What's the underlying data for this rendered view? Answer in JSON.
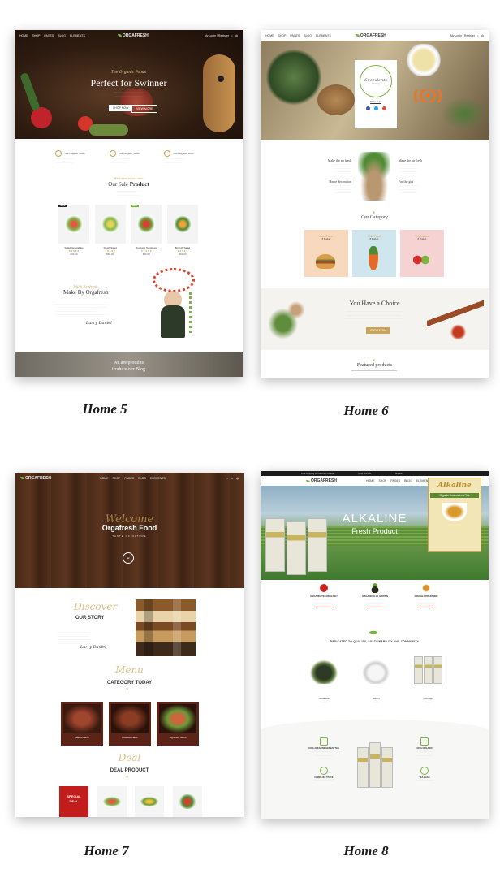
{
  "brand": "ORGAFRESH",
  "nav_links": [
    "HOME",
    "SHOP",
    "PAGES",
    "BLOG",
    "ELEMENTS"
  ],
  "nav_account": "My Login / Register",
  "home5": {
    "caption": "Home 5",
    "hero_script": "The Organic Foods",
    "hero_title": "Perfect for Swinner",
    "hero_btn1": "SHOP NOW",
    "hero_btn2": "VIEW MORE",
    "features": [
      {
        "title": "The Organic Store"
      },
      {
        "title": "The Organic Store"
      },
      {
        "title": "The Organic Store"
      }
    ],
    "sale_script": "Welcome to our sale",
    "sale_title_a": "Our Sale ",
    "sale_title_b": "Product",
    "badges": [
      "SALE",
      "NEW"
    ],
    "products": [
      {
        "name": "Salad Vegetables",
        "price": "$99.00"
      },
      {
        "name": "Fresh Salad",
        "price": "$99.00"
      },
      {
        "name": "Avocado Tomatoes",
        "price": "$99.00"
      },
      {
        "name": "Brocolli Salad",
        "price": "$99.00"
      }
    ],
    "about_script": "100% Ecofresh",
    "about_title": "Make By Orgafresh",
    "signature": "Larry Daniel",
    "blog_title_1": "We are proud to",
    "blog_title_2": "troduce our Blog"
  },
  "home6": {
    "caption": "Home 6",
    "hero_card_script": "Succulents",
    "hero_card_sub": "Trending",
    "hero_card_link": "Shop Now",
    "blocks": [
      {
        "title": "Make the air fresh"
      },
      {
        "title": "Make the air fresh"
      },
      {
        "title": "Home decoration"
      },
      {
        "title": "For the gift"
      }
    ],
    "category_title": "Our Category",
    "categories": [
      {
        "name": "Fast Food",
        "count": "8 Product",
        "bg": "#f8d9bd"
      },
      {
        "name": "Fish Food",
        "count": "8 Product",
        "bg": "#cfe6ee"
      },
      {
        "name": "Vegetables",
        "count": "8 Product",
        "bg": "#f6d3d3"
      }
    ],
    "choice_title": "You Have a Choice",
    "choice_btn": "SHOP NOW",
    "featured_title": "Featured products"
  },
  "home7": {
    "caption": "Home 7",
    "hero_script": "Welcome",
    "hero_title": "Orgafresh Food",
    "hero_sub": "TASTE OF NATURE",
    "story_script": "Discover",
    "story_title": "OUR STORY",
    "signature": "Larry Daniel",
    "cat_script": "Menu",
    "cat_title": "CATEGORY TODAY",
    "categories": [
      "Beef & Lamb",
      "Roasted Lamb",
      "Signature Menu"
    ],
    "deal_script": "Deal",
    "deal_title": "DEAL PRODUCT",
    "special_1": "SPECIAL",
    "special_2": "DEAL"
  },
  "home8": {
    "caption": "Home 8",
    "topbar": [
      "Free Shipping For All Order Of $99",
      "(000) 123-456",
      "English"
    ],
    "hero_title": "ALKALINE",
    "hero_sub": "Fresh Product",
    "pack_brand": "Alkaline",
    "pack_sub": "Organic Rooibos Leaf Tea",
    "features": [
      {
        "title": "ORGANIC TECHNOLOGY"
      },
      {
        "title": "ORGANICALLY GROWN"
      },
      {
        "title": "FRESHLY PREPARED"
      }
    ],
    "tagline": "DEDICATED TO QUALITY, SUSTAINABILITY AND COMMUNITY",
    "products": [
      "Loose Tea",
      "Tea Pot",
      "Tea Bags"
    ],
    "bottom_features": [
      "100% ALKALINE HERBAL TEA",
      "100% ORGANIC",
      "FARM LIKE TASTE",
      "TEA BAGS"
    ]
  }
}
